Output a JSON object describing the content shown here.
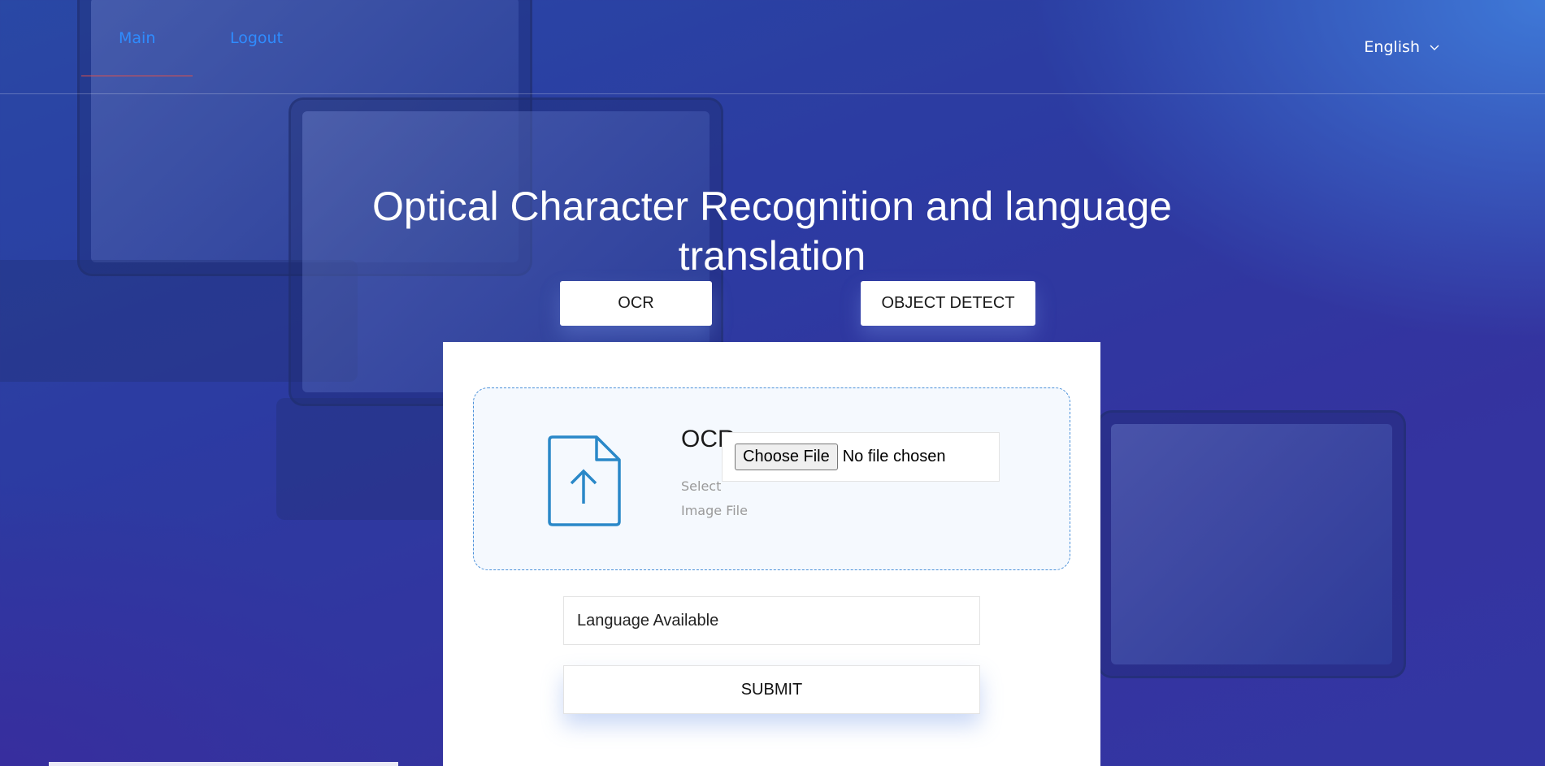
{
  "nav": {
    "main_label": "Main",
    "logout_label": "Logout",
    "language": "English"
  },
  "page": {
    "title": "Optical Character Recognition and language translation"
  },
  "modes": {
    "ocr_label": "OCR",
    "object_detect_label": "OBJECT DETECT"
  },
  "upload": {
    "heading": "OCR",
    "hint": "Select Image File",
    "choose_label": "Choose File",
    "file_status": "No file chosen"
  },
  "form": {
    "language_placeholder": "Language Available",
    "submit_label": "SUBMIT"
  },
  "colors": {
    "accent": "#2f8cff",
    "underline": "#e0504a",
    "icon": "#2a88c8"
  }
}
